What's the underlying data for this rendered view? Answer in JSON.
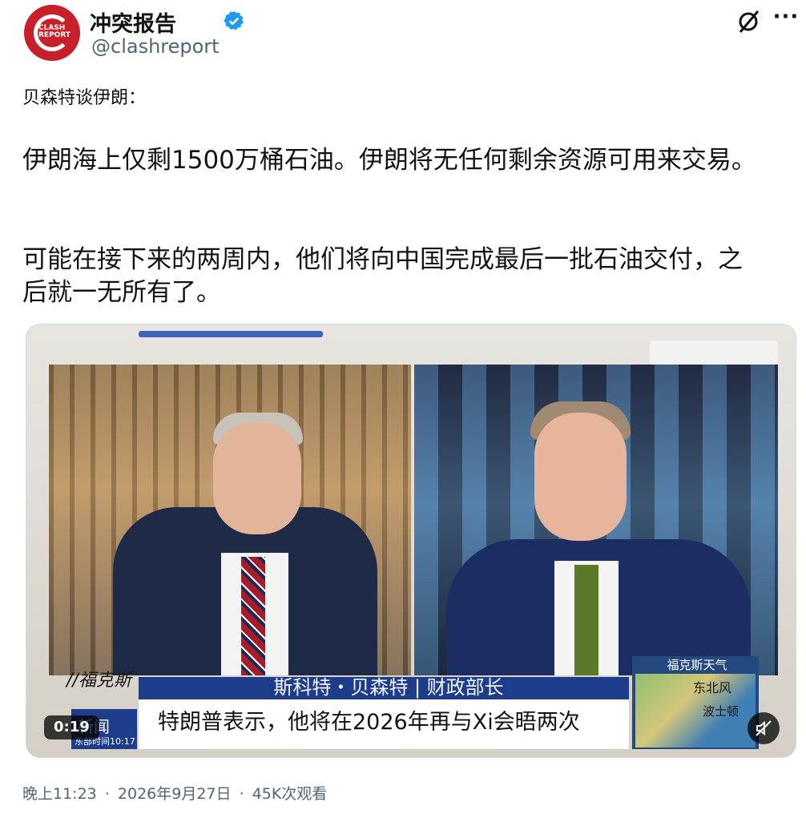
{
  "author": {
    "name": "冲突报告",
    "handle": "@clashreport",
    "avatar_text": "CLASH\nREPORT",
    "verified_icon": "verified-badge-icon",
    "accent": "#1d9bf0",
    "brand": "#c8202a"
  },
  "post": {
    "intro": "贝森特谈伊朗：",
    "paragraph1": "伊朗海上仅剩1500万桶石油。伊朗将无任何剩余资源可用来交易。",
    "paragraph2": "可能在接下来的两周内，他们将向中国完成最后一批石油交付，之后就一无所有了。"
  },
  "video": {
    "timer": "0:19",
    "lower_third": "斯科特・贝森特 | 财政部长",
    "caption": "特朗普表示，他将在2026年再与Xi会晤两次",
    "network_top": "//福克斯",
    "network_bottom": "新闻",
    "time_tag": "东部时间10:17",
    "weather_title": "福克斯天气",
    "weather_wind": "东北风",
    "weather_city": "波士顿",
    "mute_icon": "mute-icon"
  },
  "meta": {
    "time": "晚上11:23",
    "date": "2026年9月27日",
    "views": "45K次观看",
    "separator": "·"
  }
}
